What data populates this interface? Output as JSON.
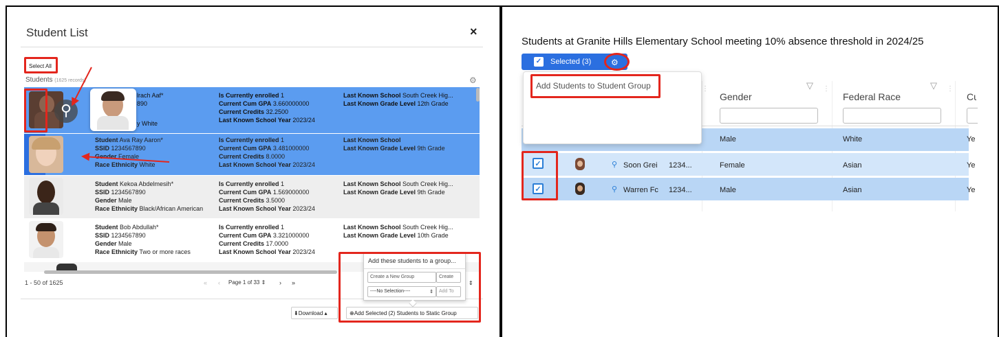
{
  "left": {
    "title": "Student List",
    "close": "×",
    "select_all": "Select All",
    "students_label": "Students",
    "records": "(1625 records)",
    "popup_title": "Add these students to a group...",
    "create_placeholder": "Create a New Group",
    "create_btn": "Create",
    "select_value": "----No Selection----",
    "add_to": "Add To",
    "pager_range": "1 - 50 of 1625",
    "page_label": "Page 1 of 33",
    "download": "Download",
    "add_selected": "Add Selected (2) Students to Static Group",
    "rows": [
      {
        "name_tail": "lrach Aaf*",
        "ssid_tail": "890",
        "race_tail": "y  White",
        "enrolled": "1",
        "gpa": "3.660000000",
        "credits": "32.2500",
        "year": "2023/24",
        "school": "South Creek Hig...",
        "grade": "12th Grade",
        "selected": true
      },
      {
        "name": "Ava Ray Aaron*",
        "ssid": "1234567890",
        "gender": "Female",
        "race": "White",
        "enrolled": "1",
        "gpa": "3.481000000",
        "credits": "8.0000",
        "year": "2023/24",
        "school": "",
        "grade": "9th Grade",
        "selected": true
      },
      {
        "name": "Kekoa Abdelmesih*",
        "ssid": "1234567890",
        "gender": "Male",
        "race": "Black/African American",
        "enrolled": "1",
        "gpa": "1.569000000",
        "credits": "3.5000",
        "year": "2023/24",
        "school": "South Creek Hig...",
        "grade": "9th Grade",
        "selected": false
      },
      {
        "name": "Bob Abdullah*",
        "ssid": "1234567890",
        "gender": "Male",
        "race": "Two or more races",
        "enrolled": "1",
        "gpa": "3.321000000",
        "credits": "17.0000",
        "year": "2023/24",
        "school": "South Creek Hig...",
        "grade": "10th Grade",
        "selected": false
      }
    ],
    "labels": {
      "student": "Student",
      "ssid": "SSID",
      "gender": "Gender",
      "race": "Race Ethnicity",
      "enrolled": "Is Currently enrolled",
      "gpa": "Current Cum GPA",
      "credits": "Current Credits",
      "year": "Last Known School Year",
      "school": "Last Known School",
      "grade": "Last Known Grade Level"
    }
  },
  "right": {
    "title": "Students at Granite Hills Elementary School meeting 10% absence threshold in 2024/25",
    "selected_btn": "Selected (3)",
    "menu_item": "Add Students to Student Group",
    "col_gender": "Gender",
    "col_race": "Federal Race",
    "col_cut": "Cu",
    "rows": [
      {
        "name": "",
        "ssid": "",
        "gender": "Male",
        "race": "White",
        "extra": "Ye"
      },
      {
        "name": "Soon Grei",
        "ssid": "1234...",
        "gender": "Female",
        "race": "Asian",
        "extra": "Ye"
      },
      {
        "name": "Warren Fc",
        "ssid": "1234...",
        "gender": "Male",
        "race": "Asian",
        "extra": "Ye"
      }
    ]
  },
  "colors": {
    "selected_blue": "#5b9cf0",
    "highlight": "#e3261d",
    "btn_blue": "#2b6fe0",
    "row_blue": "#b9d6f5"
  }
}
